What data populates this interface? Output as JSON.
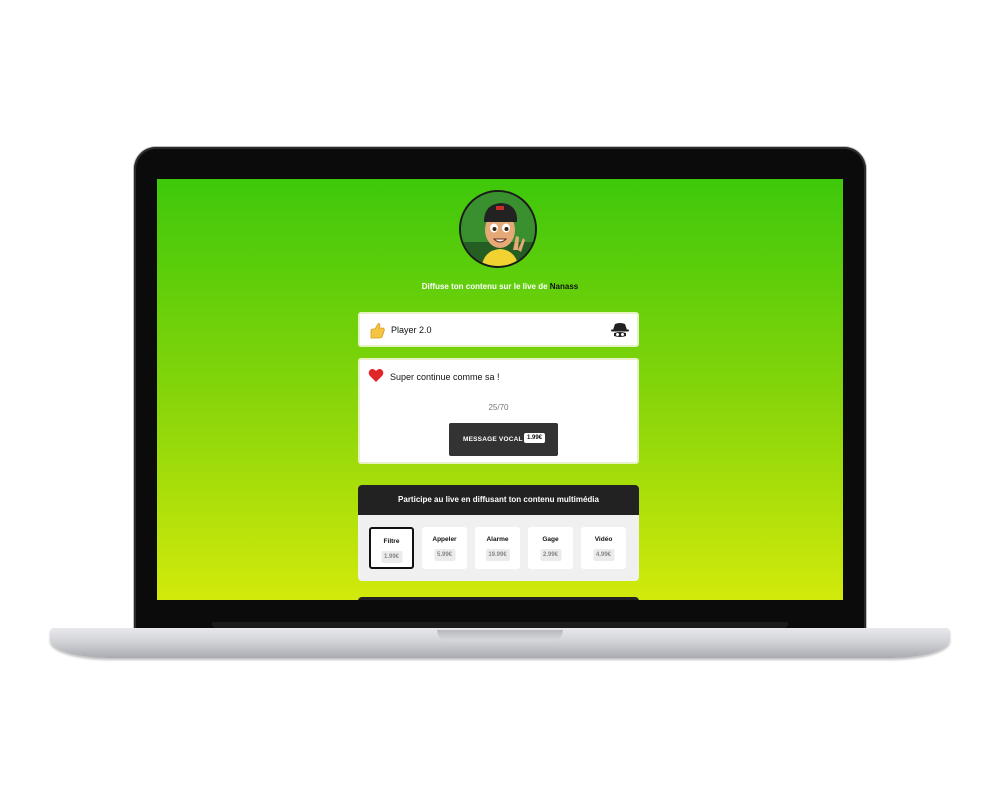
{
  "profile": {
    "tagline_prefix": "Diffuse ton contenu sur le live de",
    "streamer_name": "Nanass"
  },
  "player": {
    "name": "Player 2.0",
    "icon": "hand-icon",
    "anonymous_icon": "spy-icon"
  },
  "message": {
    "icon": "heart-icon",
    "text": "Super continue comme sa !",
    "char_count": "25/70",
    "vocal_label": "MESSAGE VOCAL",
    "vocal_price": "1.99€"
  },
  "participate": {
    "title": "Participe au live en diffusant ton contenu multimédia",
    "options": [
      {
        "label": "Filtre",
        "price": "1.99€",
        "selected": true
      },
      {
        "label": "Appeler",
        "price": "5.99€",
        "selected": false
      },
      {
        "label": "Alarme",
        "price": "19.99€",
        "selected": false
      },
      {
        "label": "Gage",
        "price": "2.99€",
        "selected": false
      },
      {
        "label": "Vidéo",
        "price": "4.99€",
        "selected": false
      }
    ]
  },
  "colors": {
    "gradient_top": "#3ec80b",
    "gradient_bottom": "#d2ea0b",
    "dark": "#222222",
    "heart": "#e0262b"
  }
}
